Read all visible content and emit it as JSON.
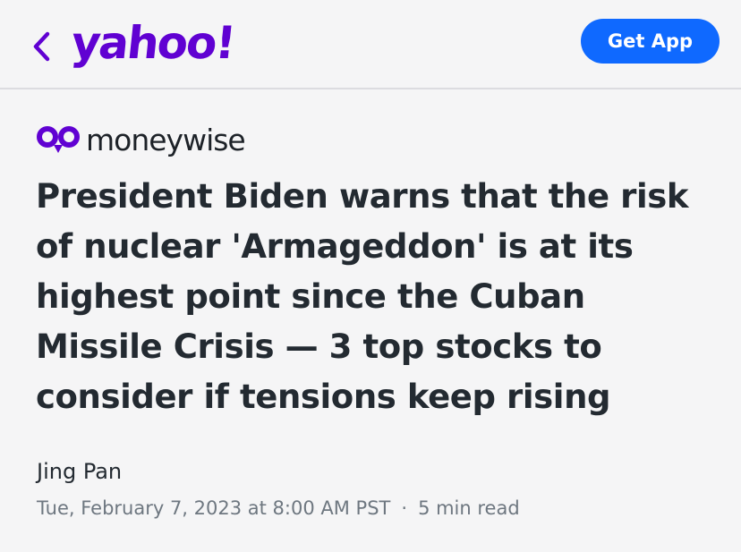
{
  "header": {
    "logo_text": "yahoo!",
    "get_app_label": "Get App"
  },
  "article": {
    "source_name": "moneywise",
    "headline": "President Biden warns that the risk of nuclear 'Armageddon' is at its highest point since the Cuban Missile Crisis — 3 top stocks to consider if tensions keep rising",
    "author": "Jing Pan",
    "date": "Tue, February 7, 2023 at 8:00 AM PST",
    "separator": "·",
    "read_time": "5 min read"
  },
  "colors": {
    "brand_purple": "#6001d2",
    "button_blue": "#0f69ff",
    "text_dark": "#232a31",
    "text_muted": "#6e7780",
    "background": "#f5f5f6"
  },
  "icons": {
    "back": "chevron-left-icon",
    "source_logo": "moneywise-logo-icon"
  }
}
